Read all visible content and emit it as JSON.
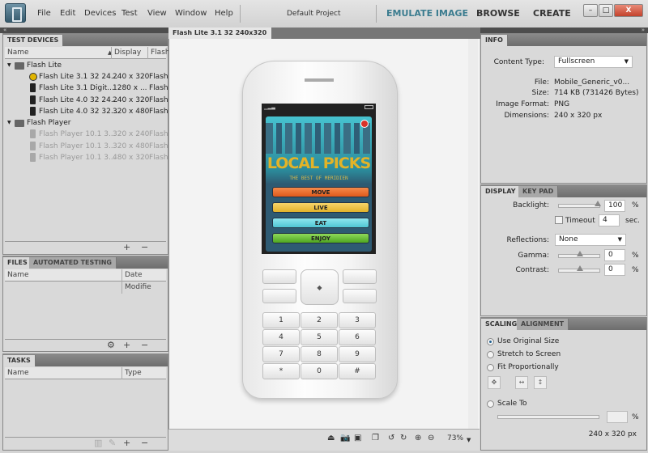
{
  "menu": [
    "File",
    "Edit",
    "Devices",
    "Test",
    "View",
    "Window",
    "Help"
  ],
  "project": "Default Project",
  "modes": {
    "emulate": "EMULATE IMAGE",
    "browse": "BROWSE",
    "create": "CREATE"
  },
  "window_controls": {
    "minimize": "–",
    "maximize": "□",
    "close": "X"
  },
  "colors": {
    "accent": "#3b7c8f"
  },
  "devices": {
    "tab": "TEST DEVICES",
    "headers": {
      "name": "Name",
      "display": "Display",
      "flash": "Flash"
    },
    "groups": [
      {
        "name": "Flash Lite",
        "items": [
          {
            "name": "Flash Lite 3.1 32 24...",
            "display": "240 x 320",
            "flash": "Flash"
          },
          {
            "name": "Flash Lite 3.1 Digit...",
            "display": "1280 x ...",
            "flash": "Flash"
          },
          {
            "name": "Flash Lite 4.0 32 24...",
            "display": "240 x 320",
            "flash": "Flash"
          },
          {
            "name": "Flash Lite 4.0 32 32...",
            "display": "320 x 480",
            "flash": "Flash"
          }
        ]
      },
      {
        "name": "Flash Player",
        "items": [
          {
            "name": "Flash Player 10.1 3...",
            "display": "320 x 240",
            "flash": "Flash"
          },
          {
            "name": "Flash Player 10.1 3...",
            "display": "320 x 480",
            "flash": "Flash"
          },
          {
            "name": "Flash Player 10.1 3...",
            "display": "480 x 320",
            "flash": "Flash"
          }
        ]
      }
    ]
  },
  "files": {
    "tabs": [
      "FILES",
      "AUTOMATED TESTING"
    ],
    "headers": {
      "name": "Name",
      "date": "Date Modifie"
    }
  },
  "tasks": {
    "tab": "TASKS",
    "headers": {
      "name": "Name",
      "type": "Type"
    }
  },
  "center": {
    "tab": "Flash Lite 3.1 32 240x320",
    "zoom": "73%"
  },
  "app": {
    "title": "LOCAL PICKS",
    "subtitle": "THE BEST OF MERIDIEN",
    "buttons": [
      "MOVE",
      "LIVE",
      "EAT",
      "ENJOY"
    ]
  },
  "keypad": [
    "1",
    "2",
    "3",
    "4",
    "5",
    "6",
    "7",
    "8",
    "9",
    "*",
    "0",
    "#"
  ],
  "info": {
    "tab": "INFO",
    "content_type_label": "Content Type:",
    "content_type": "Fullscreen",
    "file_label": "File:",
    "file": "Mobile_Generic_v0...",
    "size_label": "Size:",
    "size": "714 KB (731426 Bytes)",
    "format_label": "Image Format:",
    "format": "PNG",
    "dims_label": "Dimensions:",
    "dims": "240 x 320 px"
  },
  "display": {
    "tabs": [
      "DISPLAY",
      "KEY PAD"
    ],
    "backlight_label": "Backlight:",
    "backlight": "100",
    "backlight_value": 100,
    "timeout_label": "Timeout",
    "timeout": "4",
    "sec": "sec.",
    "reflections_label": "Reflections:",
    "reflections": "None",
    "gamma_label": "Gamma:",
    "gamma": "0",
    "contrast_label": "Contrast:",
    "contrast": "0",
    "pct": "%"
  },
  "scaling": {
    "tabs": [
      "SCALING",
      "ALIGNMENT"
    ],
    "options": [
      "Use Original Size",
      "Stretch to Screen",
      "Fit Proportionally",
      "Scale To"
    ],
    "pct": "%",
    "result": "240 x 320 px"
  }
}
